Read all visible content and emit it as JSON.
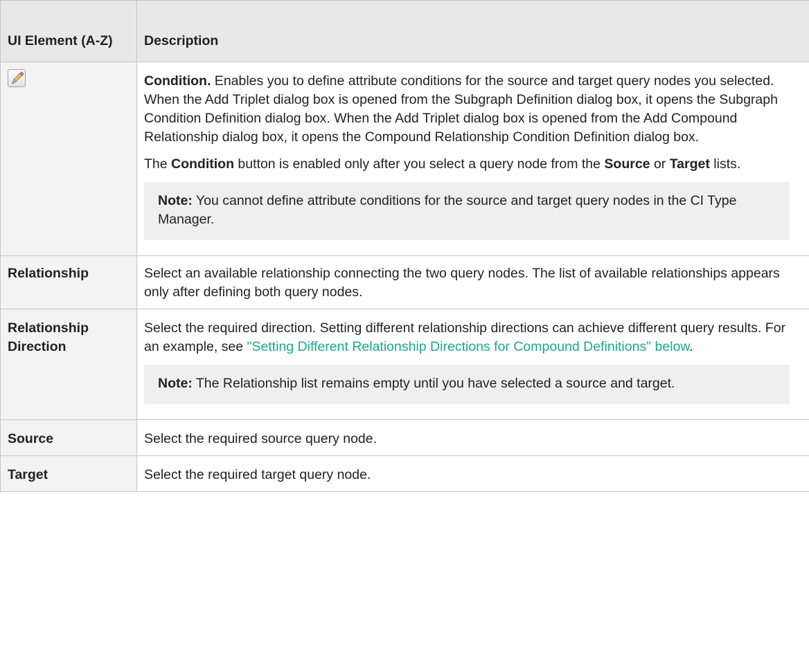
{
  "header": {
    "col1": "UI Element (A-Z)",
    "col2": "Description"
  },
  "rows": {
    "condition": {
      "icon": "pencil-icon",
      "title": "Condition.",
      "text": " Enables you to define attribute conditions for the source and target query nodes you selected. When the Add Triplet dialog box is opened from the Subgraph Definition dialog box, it opens the Subgraph Condition Definition dialog box. When the Add Triplet dialog box is opened from the Add Compound Relationship dialog box, it opens the Compound Relationship Condition Definition dialog box.",
      "p2_a": "The ",
      "p2_b": "Condition",
      "p2_c": " button is enabled only after you select a query node from the ",
      "p2_d": "Source",
      "p2_e": " or ",
      "p2_f": "Target",
      "p2_g": " lists.",
      "note_label": "Note:",
      "note_text": " You cannot define attribute conditions for the source and target query nodes in the CI Type Manager."
    },
    "relationship": {
      "label": "Relationship",
      "text": "Select an available relationship connecting the two query nodes. The list of available relationships appears only after defining both query nodes."
    },
    "relationship_direction": {
      "label": "Relationship Direction",
      "text": "Select the required direction. Setting different relationship directions can achieve different query results. For an example, see ",
      "link": "\"Setting Different Relationship Directions for Compound Definitions\" below",
      "text_end": ".",
      "note_label": "Note:",
      "note_text": " The Relationship list remains empty until you have selected a source and target."
    },
    "source": {
      "label": "Source",
      "text": "Select the required source query node."
    },
    "target": {
      "label": "Target",
      "text": "Select the required target query node."
    }
  }
}
